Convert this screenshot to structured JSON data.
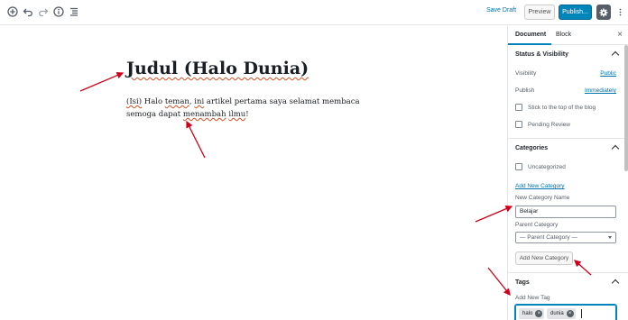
{
  "toolbar": {
    "icons": [
      "add-block-icon",
      "undo-icon",
      "redo-icon",
      "info-icon",
      "outline-icon"
    ],
    "save_draft_label": "Save Draft",
    "preview_label": "Preview",
    "publish_label": "Publish...",
    "settings_icon": "gear-icon",
    "more_icon": "more-vertical-icon"
  },
  "editor": {
    "title": "Judul (Halo Dunia)",
    "body_parts": [
      "(Isi)",
      " Halo ",
      "teman",
      ", ",
      "ini",
      " artikel pertama saya selamat membaca semoga dapat ",
      "menambah",
      " ",
      "ilmu",
      "!"
    ]
  },
  "sidebar": {
    "tabs": {
      "document": "Document",
      "block": "Block"
    },
    "close_glyph": "×",
    "status": {
      "heading": "Status & Visibility",
      "visibility_label": "Visibility",
      "visibility_value": "Public",
      "publish_label": "Publish",
      "publish_value": "Immediately",
      "stick_label": "Stick to the top of the blog",
      "pending_label": "Pending Review"
    },
    "categories": {
      "heading": "Categories",
      "items": [
        "Uncategorized"
      ],
      "add_new_link": "Add New Category",
      "new_name_label": "New Category Name",
      "new_name_value": "Belajar",
      "parent_label": "Parent Category",
      "parent_value": "— Parent Category —",
      "add_button": "Add New Category"
    },
    "tags": {
      "heading": "Tags",
      "add_label": "Add New Tag",
      "chips": [
        "halo",
        "dunia"
      ],
      "remove_glyph": "×"
    }
  },
  "colors": {
    "accent": "#0085ba",
    "link": "#0073aa",
    "annotation_arrow": "#d0021b"
  }
}
